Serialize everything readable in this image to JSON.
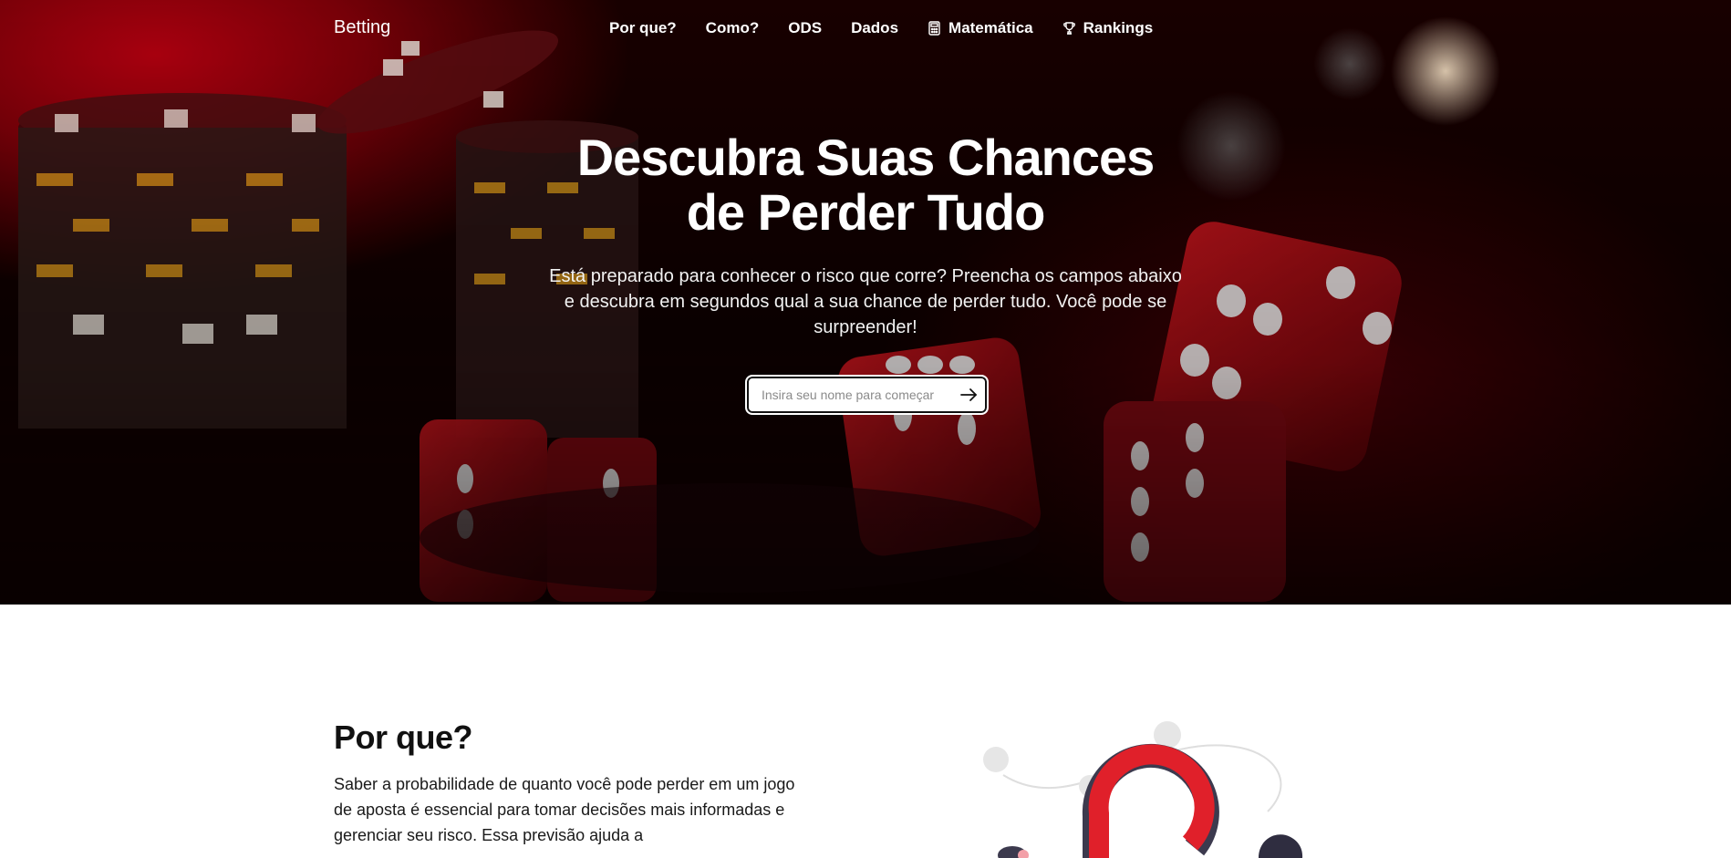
{
  "nav": {
    "brand": "Betting",
    "links": [
      {
        "label": "Por que?",
        "icon": ""
      },
      {
        "label": "Como?",
        "icon": ""
      },
      {
        "label": "ODS",
        "icon": ""
      },
      {
        "label": "Dados",
        "icon": ""
      },
      {
        "label": "Matemática",
        "icon": "calculator-icon"
      },
      {
        "label": "Rankings",
        "icon": "trophy-icon"
      }
    ]
  },
  "hero": {
    "title_line1": "Descubra Suas Chances",
    "title_line2": "de Perder Tudo",
    "subtitle": "Está preparado para conhecer o risco que corre? Preencha os campos abaixo e descubra em segundos qual a sua chance de perder tudo. Você pode se surpreender!",
    "input_placeholder": "Insira seu nome para começar",
    "input_value": "",
    "submit_icon": "arrow-right-icon"
  },
  "why": {
    "title": "Por que?",
    "text": "Saber a probabilidade de quanto você pode perder em um jogo de aposta é essencial para tomar decisões mais informadas e gerenciar seu risco. Essa previsão ajuda a"
  },
  "colors": {
    "hero_red": "#b30010",
    "accent_red": "#e0202a",
    "text_dark": "#111111",
    "white": "#ffffff"
  }
}
